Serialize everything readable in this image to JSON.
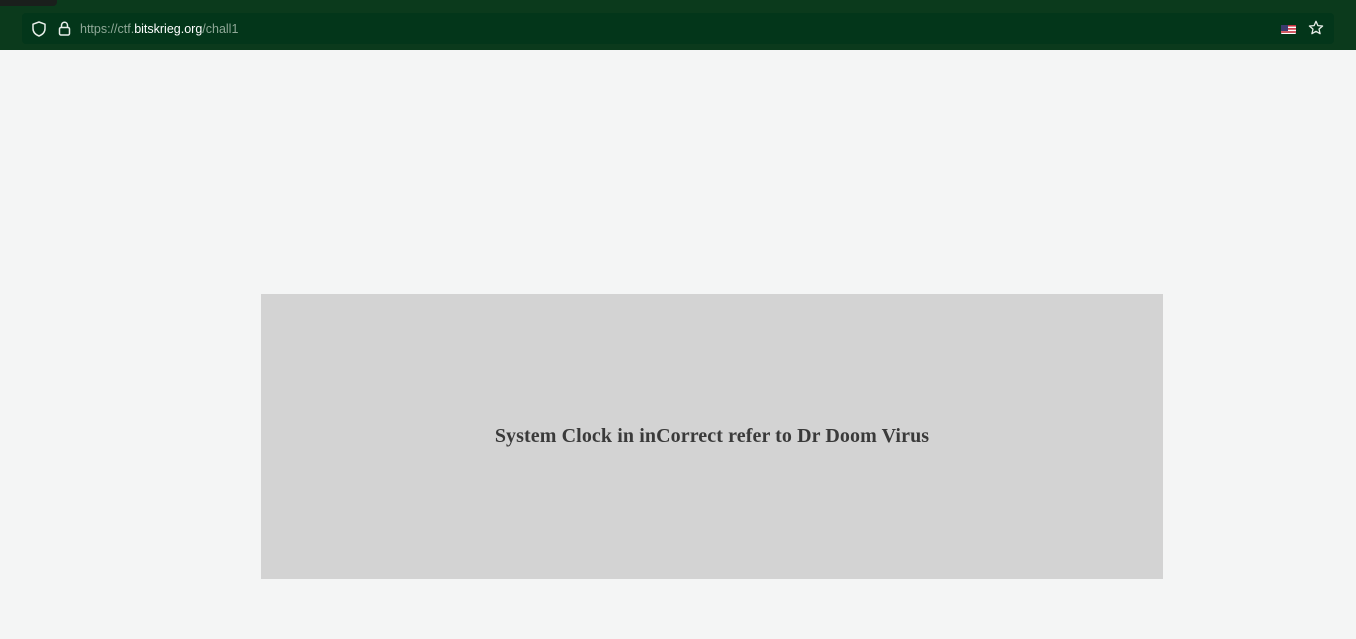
{
  "browser": {
    "url_prefix": "https://ctf.",
    "url_host": "bitskrieg.org",
    "url_path": "/chall1",
    "icons": [
      "shield-icon",
      "lock-icon",
      "us-flag-icon",
      "star-icon"
    ],
    "theme_color": "#0b3a1c"
  },
  "main": {
    "message": "System Clock in inCorrect refer to Dr Doom Virus",
    "box_color": "#d3d3d3"
  }
}
